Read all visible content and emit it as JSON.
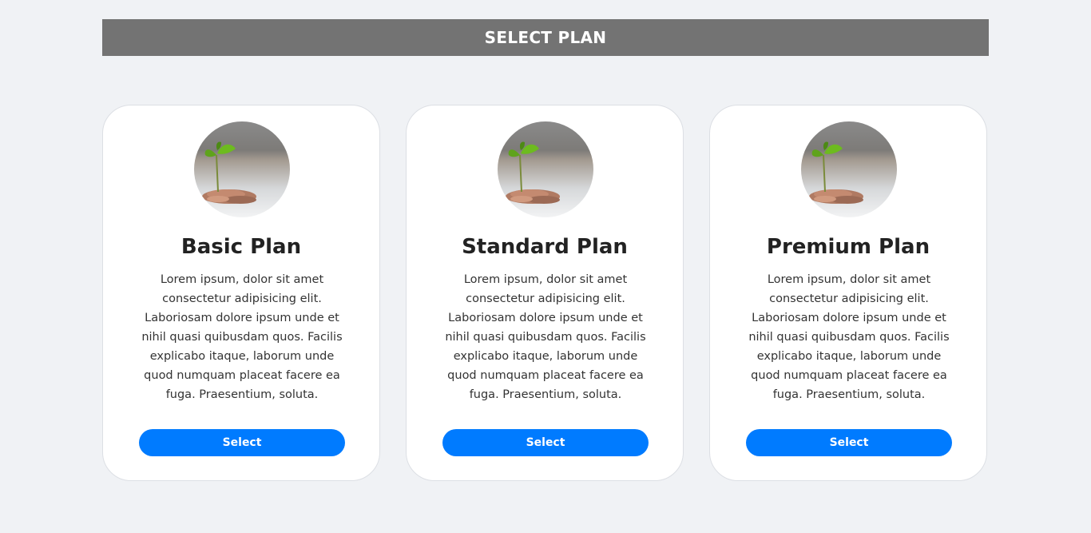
{
  "header": {
    "title": "SELECT PLAN"
  },
  "plans": [
    {
      "title": "Basic Plan",
      "description": "Lorem ipsum, dolor sit amet consectetur adipisicing elit. Laboriosam dolore ipsum unde et nihil quasi quibusdam quos. Facilis explicabo itaque, laborum unde quod numquam placeat facere ea fuga. Praesentium, soluta.",
      "button_label": "Select",
      "image_icon": "plant-coins-image"
    },
    {
      "title": "Standard Plan",
      "description": "Lorem ipsum, dolor sit amet consectetur adipisicing elit. Laboriosam dolore ipsum unde et nihil quasi quibusdam quos. Facilis explicabo itaque, laborum unde quod numquam placeat facere ea fuga. Praesentium, soluta.",
      "button_label": "Select",
      "image_icon": "plant-coins-image"
    },
    {
      "title": "Premium Plan",
      "description": "Lorem ipsum, dolor sit amet consectetur adipisicing elit. Laboriosam dolore ipsum unde et nihil quasi quibusdam quos. Facilis explicabo itaque, laborum unde quod numquam placeat facere ea fuga. Praesentium, soluta.",
      "button_label": "Select",
      "image_icon": "plant-coins-image"
    }
  ],
  "colors": {
    "header_bg": "#737373",
    "page_bg": "#f0f2f5",
    "button_bg": "#007bff"
  }
}
